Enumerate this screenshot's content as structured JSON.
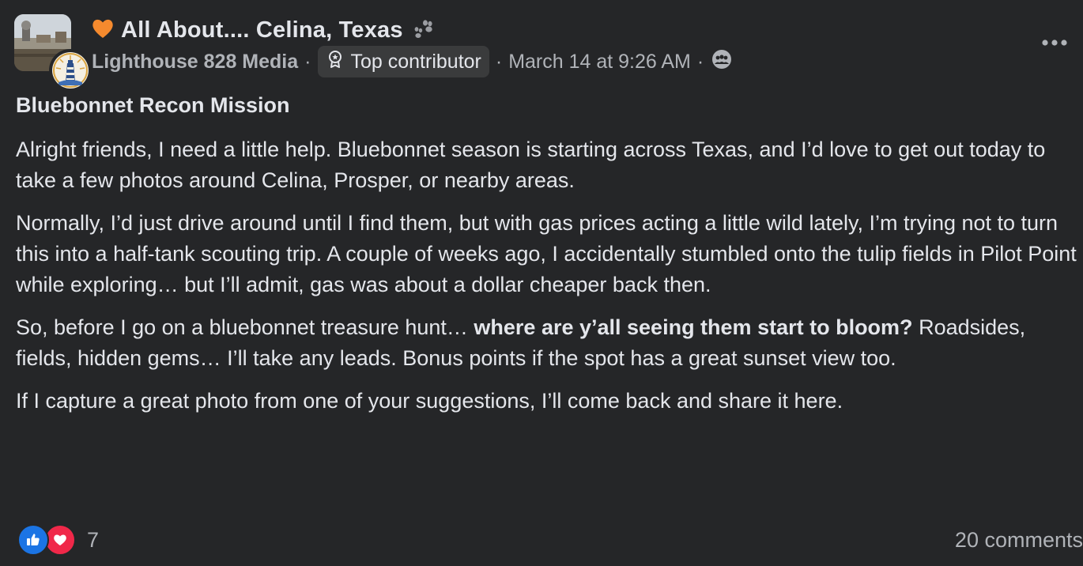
{
  "group": {
    "heart_icon": "orange-heart-icon",
    "name": "All About.... Celina, Texas",
    "paw_icon": "paw-prints-icon"
  },
  "meta": {
    "author": "Lighthouse 828 Media",
    "separator": "·",
    "badge_icon": "contributor-badge-icon",
    "badge_label": "Top contributor",
    "date": "March 14 at 9:26 AM",
    "audience_icon": "group-members-icon"
  },
  "menu": {
    "icon": "more-options-icon"
  },
  "post": {
    "title": "Bluebonnet Recon Mission",
    "p1": "Alright friends, I need a little help. Bluebonnet season is starting across Texas, and I’d love to get out today to take a few photos around Celina, Prosper, or nearby areas.",
    "p2": "Normally, I’d just drive around until I find them, but with gas prices acting a little wild lately, I’m trying not to turn this into a half-tank scouting trip. A couple of weeks ago, I accidentally stumbled onto the tulip fields in Pilot Point while exploring… but I’ll admit, gas was about a dollar cheaper back then.",
    "p3_start": "So, before I go on a bluebonnet treasure hunt… ",
    "p3_bold": "where are y’all seeing them start to bloom?",
    "p3_end": " Roadsides, fields, hidden gems… I’ll take any leads. Bonus points if the spot has a great sunset view too.",
    "p4": "If I capture a great photo from one of your suggestions, I’ll come back and share it here."
  },
  "footer": {
    "like_icon": "like-thumb-icon",
    "love_icon": "love-heart-icon",
    "reaction_count": "7",
    "comments": "20 comments"
  },
  "colors": {
    "background": "#252628",
    "text_primary": "#e4e6eb",
    "text_secondary": "#b0b3b8",
    "badge_bg": "#3a3b3c",
    "like_blue": "#1b74e4",
    "love_red": "#f02849"
  }
}
